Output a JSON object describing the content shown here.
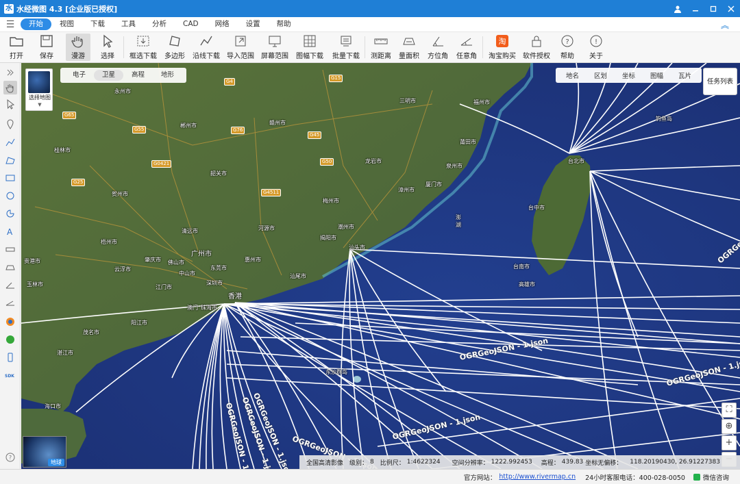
{
  "app": {
    "title": "水经微图 4.3 [企业版已授权]"
  },
  "menu": {
    "items": [
      "开始",
      "视图",
      "下载",
      "工具",
      "分析",
      "CAD",
      "网络",
      "设置",
      "帮助"
    ],
    "active": "开始"
  },
  "toolbar": {
    "items": [
      "打开",
      "保存",
      "漫游",
      "选择",
      "框选下载",
      "多边形",
      "沿线下载",
      "导入范围",
      "屏幕范围",
      "图幅下载",
      "批量下载",
      "测距离",
      "量面积",
      "方位角",
      "任意角",
      "淘宝购买",
      "软件授权",
      "帮助",
      "关于"
    ],
    "active": "漫游"
  },
  "map": {
    "basemap_selector": "选择地图",
    "type_tabs": [
      "电子",
      "卫星",
      "高程",
      "地形"
    ],
    "active_type": "卫星",
    "overlay_tabs": [
      "地名",
      "区划",
      "坐标",
      "图幅",
      "瓦片"
    ],
    "task_list": "任务列表",
    "earth_label": "地球",
    "places": [
      "福州市",
      "三明市",
      "莆田市",
      "泉州市",
      "厦门市",
      "漳州市",
      "龙岩市",
      "赣州市",
      "郴州市",
      "永州市",
      "桂林市",
      "贺州市",
      "梧州市",
      "韶关市",
      "清远市",
      "广州市",
      "佛山市",
      "东莞市",
      "惠州市",
      "河源市",
      "梅州市",
      "潮州市",
      "汕头市",
      "揭阳市",
      "汕尾市",
      "深圳市",
      "香港",
      "澳门",
      "江门市",
      "中山市",
      "珠海市",
      "肇庆市",
      "云浮市",
      "阳江市",
      "茂名市",
      "湛江市",
      "玉林市",
      "贵港市",
      "海口市",
      "台北市",
      "台中市",
      "台南市",
      "高雄市",
      "钓鱼岛",
      "东沙群岛",
      "澎湖"
    ],
    "roads": [
      "G15",
      "G35",
      "G65",
      "G76",
      "G55",
      "G4",
      "G45",
      "G0421",
      "G50",
      "G4511",
      "G25"
    ],
    "geojson_label": "OGRGeoJSON - 1.json"
  },
  "infobar": {
    "source": "全国高清影像",
    "level_label": "级别：",
    "level": "8",
    "scale_label": "比例尺：",
    "scale": "1:4622324",
    "res_label": "空间分辨率：",
    "res": "1222.992453",
    "elev_label": "高程：",
    "elev": "439.83",
    "offset_label": "坐标无偏移：",
    "coords": "118.20190430, 26.91227383"
  },
  "status": {
    "site_label": "官方网站：",
    "site_url": "http://www.rivermap.cn",
    "hotline": "24小时客服电话：400-028-0050",
    "wechat": "微信咨询"
  },
  "colors": {
    "accent": "#2e8ce6",
    "title_bg": "#1f7fd6",
    "ocean": "#243a8a",
    "land": "#4f6b38",
    "cable": "#ffffff",
    "road_shield": "#d59a2a"
  }
}
